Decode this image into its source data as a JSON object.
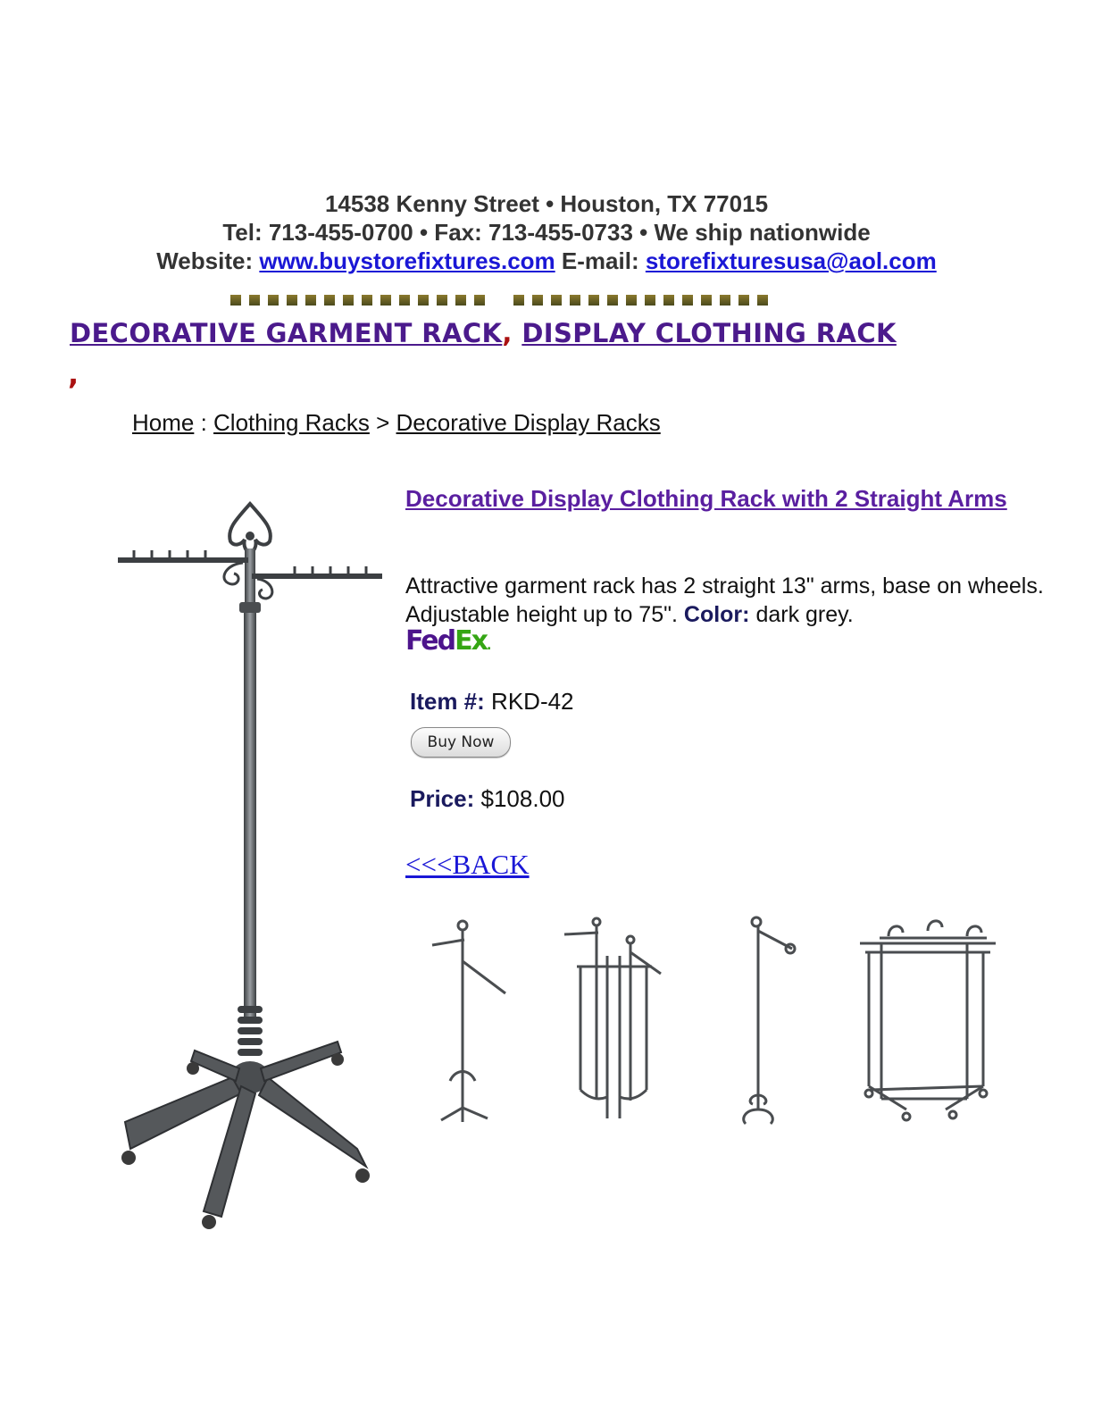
{
  "contact": {
    "address": "14538 Kenny Street • Houston, TX 77015",
    "phone_line": "Tel: 713-455-0700 • Fax: 713-455-0733 • We ship nationwide",
    "website_label": "Website:",
    "website_link": "www.buystorefixtures.com",
    "email_label": "E-mail:",
    "email_link": "storefixturesusa@aol.com"
  },
  "headline": {
    "link1": "DECORATIVE GARMENT RACK",
    "separator": ",",
    "link2": "DISPLAY CLOTHING RACK",
    "trailing": ","
  },
  "breadcrumb": {
    "home": "Home",
    "sep1": " : ",
    "category": "Clothing Racks",
    "sep2": " > ",
    "current": "Decorative Display Racks"
  },
  "product": {
    "title": "Decorative Display Clothing Rack with 2 Straight Arms",
    "description": "Attractive garment rack has 2 straight 13\" arms, base on wheels. Adjustable height up to 75\".",
    "color_label": "Color:",
    "color_value": "dark grey.",
    "shipping_logo": {
      "part1": "Fed",
      "part2": "Ex",
      "mark": "."
    },
    "item_label": "Item #:",
    "item_value": "RKD-42",
    "buy_button": "Buy Now",
    "price_label": "Price:",
    "price_value": "$108.00"
  },
  "back_link": "<<<BACK",
  "icons": {
    "main_image": "garment-rack-image",
    "thumbnails": [
      "waterfall-rack-thumbnail",
      "two-way-rack-thumbnail",
      "single-arm-rack-thumbnail",
      "rolling-rack-thumbnail"
    ]
  },
  "colors": {
    "link_blue": "#1a17d6",
    "headline_purple": "#4b1a8c",
    "title_purple": "#5a1fa0",
    "label_navy": "#1a1a5e",
    "accent_red": "#aa1111",
    "fedex_purple": "#4d148c",
    "fedex_green": "#35a614"
  }
}
